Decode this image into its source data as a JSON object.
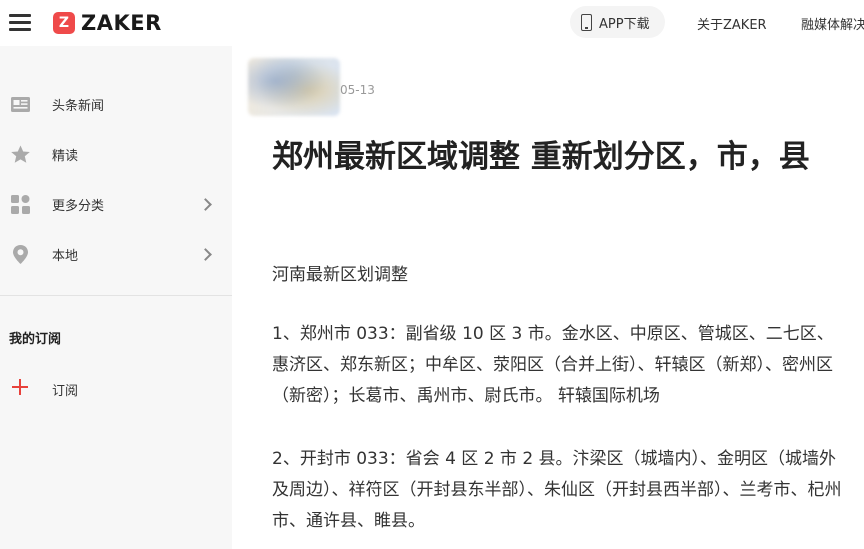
{
  "header": {
    "logo_mark": "Z",
    "logo_text": "ZAKER",
    "app_download": "APP下载",
    "about": "关于ZAKER",
    "media_solutions": "融媒体解决"
  },
  "sidebar": {
    "items": [
      {
        "label": "头条新闻",
        "icon": "newspaper-icon"
      },
      {
        "label": "精读",
        "icon": "star-icon"
      },
      {
        "label": "更多分类",
        "icon": "categories-icon"
      },
      {
        "label": "本地",
        "icon": "location-pin-icon"
      }
    ],
    "subscription_title": "我的订阅",
    "subscribe_label": "订阅"
  },
  "article": {
    "date": "05-13",
    "title": "郑州最新区域调整 重新划分区，市，县",
    "paragraphs": [
      "河南最新区划调整",
      "1、郑州市 033：副省级 10 区 3 市。金水区、中原区、管城区、二七区、惠济区、郑东新区；中牟区、荥阳区（合并上街）、轩辕区（新郑）、密州区（新密）；长葛市、禹州市、尉氏市。 轩辕国际机场",
      "2、开封市 033：省会 4 区 2 市 2 县。汴梁区（城墙内）、金明区（城墙外及周边）、祥符区（开封县东半部）、朱仙区（开封县西半部）、兰考市、杞州市、通许县、睢县。"
    ]
  },
  "colors": {
    "brand": "#ef4a4a",
    "sidebar_bg": "#f7f7f7",
    "accent_plus": "#e8413b"
  }
}
